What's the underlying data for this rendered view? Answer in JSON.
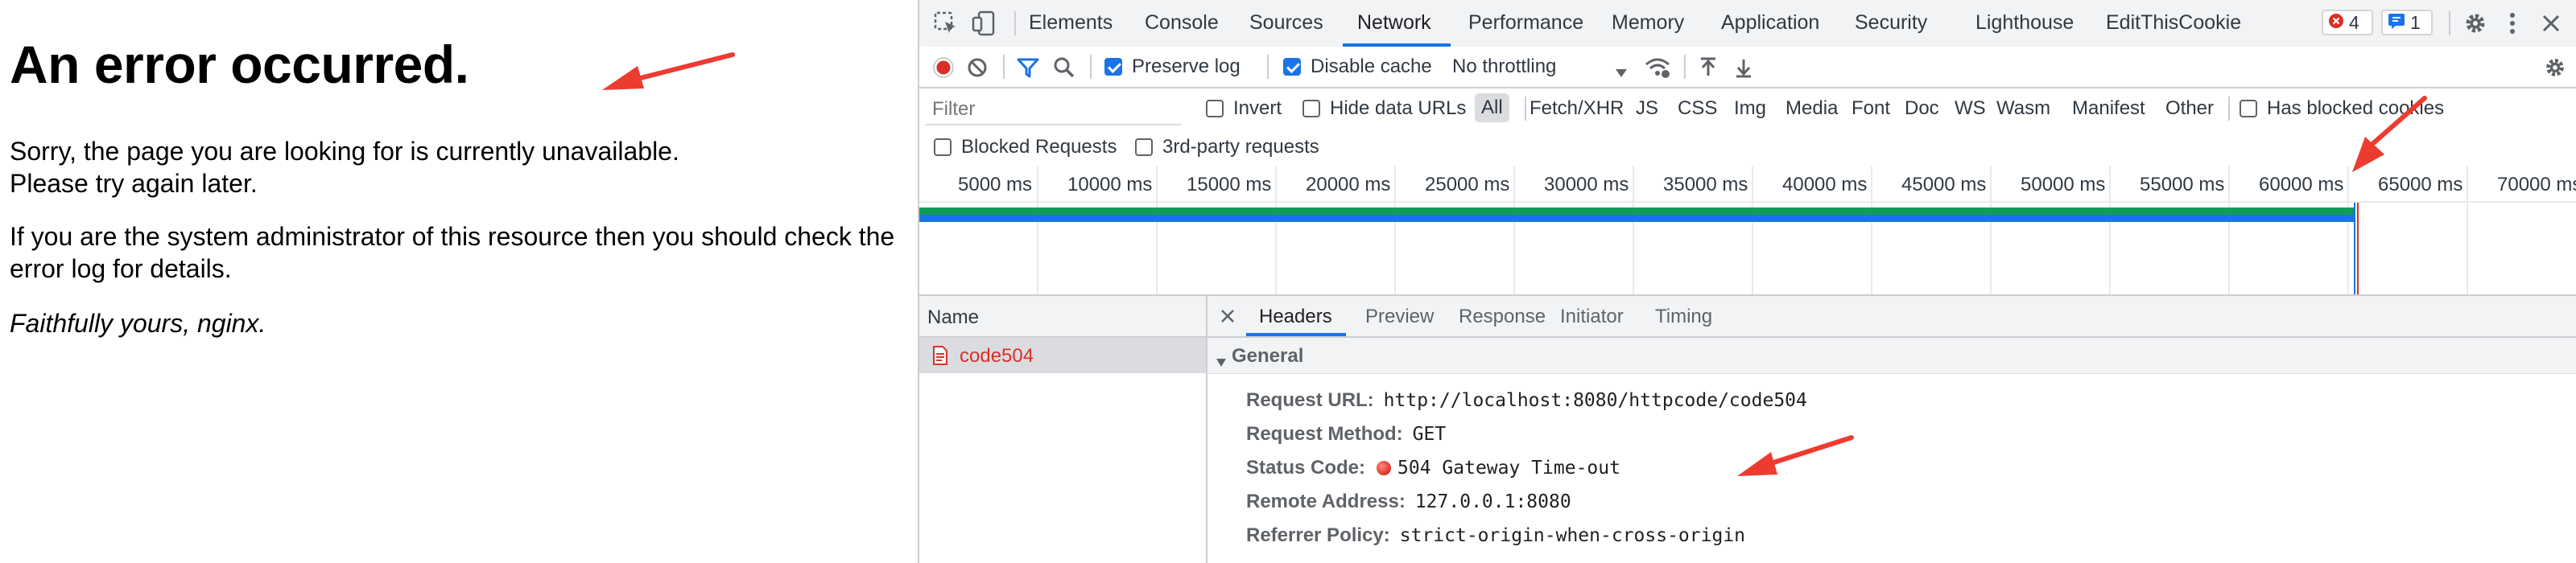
{
  "page": {
    "heading": "An error occurred.",
    "para1": "Sorry, the page you are looking for is currently unavailable.\nPlease try again later.",
    "para2": "If you are the system administrator of this resource then you should check the error log for details.",
    "para3": "Faithfully yours, nginx."
  },
  "devtools": {
    "tabs": [
      "Elements",
      "Console",
      "Sources",
      "Network",
      "Performance",
      "Memory",
      "Application",
      "Security",
      "Lighthouse",
      "EditThisCookie"
    ],
    "active_tab": "Network",
    "error_count": "4",
    "message_count": "1",
    "toolbar": {
      "preserve_log": "Preserve log",
      "disable_cache": "Disable cache",
      "throttling": "No throttling"
    },
    "filter": {
      "placeholder": "Filter",
      "invert": "Invert",
      "hide_data_urls": "Hide data URLs",
      "types": [
        "All",
        "Fetch/XHR",
        "JS",
        "CSS",
        "Img",
        "Media",
        "Font",
        "Doc",
        "WS",
        "Wasm",
        "Manifest",
        "Other"
      ],
      "has_blocked_cookies": "Has blocked cookies",
      "blocked_requests": "Blocked Requests",
      "third_party": "3rd-party requests"
    },
    "timeline_ticks": [
      "5000 ms",
      "10000 ms",
      "15000 ms",
      "20000 ms",
      "25000 ms",
      "30000 ms",
      "35000 ms",
      "40000 ms",
      "45000 ms",
      "50000 ms",
      "55000 ms",
      "60000 ms",
      "65000 ms",
      "70000 ms"
    ],
    "name_header": "Name",
    "requests": [
      {
        "name": "code504"
      }
    ],
    "detail_tabs": [
      "Headers",
      "Preview",
      "Response",
      "Initiator",
      "Timing"
    ],
    "general_section": "General",
    "general": {
      "request_url_k": "Request URL:",
      "request_url_v": "http://localhost:8080/httpcode/code504",
      "request_method_k": "Request Method:",
      "request_method_v": "GET",
      "status_code_k": "Status Code:",
      "status_code_v": "504 Gateway Time-out",
      "remote_address_k": "Remote Address:",
      "remote_address_v": "127.0.0.1:8080",
      "referrer_policy_k": "Referrer Policy:",
      "referrer_policy_v": "strict-origin-when-cross-origin"
    },
    "colors": {
      "accent": "#1a73e8",
      "error_red": "#d93025",
      "annotation_arrow": "#ee3b2f",
      "waterfall_green": "#0f9d58"
    }
  }
}
